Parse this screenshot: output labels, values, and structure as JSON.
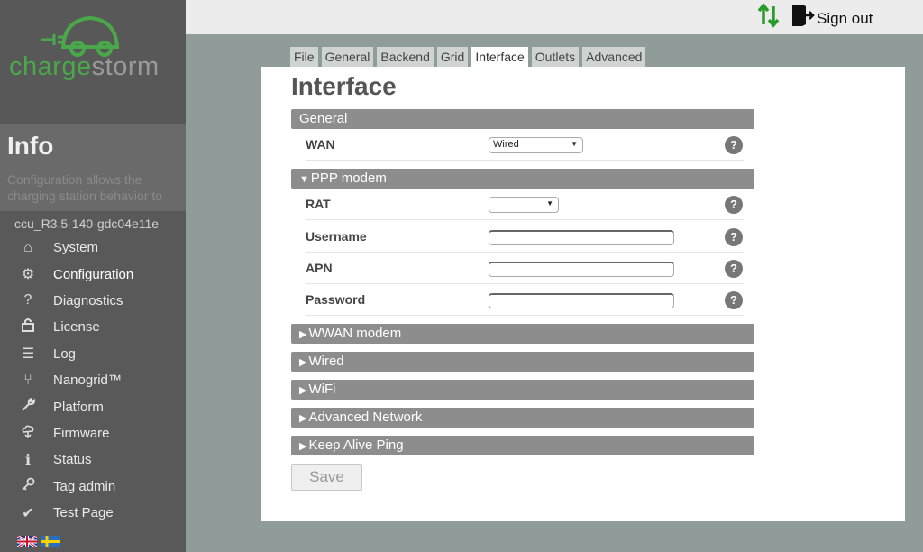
{
  "brand": {
    "part1": "charge",
    "part2": "storm",
    "accent": "#4aa84a"
  },
  "info": {
    "title": "Info",
    "description": "Configuration allows the charging station behavior to"
  },
  "version": "ccu_R3.5-140-gdc04e11e",
  "menu": [
    {
      "label": "System",
      "icon": "home-icon",
      "glyph": "⌂"
    },
    {
      "label": "Configuration",
      "icon": "gear-icon",
      "glyph": "⚙"
    },
    {
      "label": "Diagnostics",
      "icon": "question-icon",
      "glyph": "?"
    },
    {
      "label": "License",
      "icon": "lock-icon",
      "glyph": "🔓"
    },
    {
      "label": "Log",
      "icon": "list-icon",
      "glyph": "☰"
    },
    {
      "label": "Nanogrid™",
      "icon": "network-icon",
      "glyph": "⑂"
    },
    {
      "label": "Platform",
      "icon": "wrench-icon",
      "glyph": "🔧"
    },
    {
      "label": "Firmware",
      "icon": "cloud-icon",
      "glyph": "⛅"
    },
    {
      "label": "Status",
      "icon": "info-icon",
      "glyph": "i"
    },
    {
      "label": "Tag admin",
      "icon": "key-icon",
      "glyph": "⚷"
    },
    {
      "label": "Test Page",
      "icon": "check-icon",
      "glyph": "✔"
    }
  ],
  "topbar": {
    "signout_label": "Sign out",
    "sync_icon": "sync-arrows-icon"
  },
  "tabs": [
    "File",
    "General",
    "Backend",
    "Grid",
    "Interface",
    "Outlets",
    "Advanced"
  ],
  "active_tab": "Interface",
  "page_title": "Interface",
  "sections": {
    "general": "General",
    "ppp": "PPP modem",
    "wwan": "WWAN modem",
    "wired": "Wired",
    "wifi": "WiFi",
    "advanced_network": "Advanced Network",
    "keep_alive": "Keep Alive Ping"
  },
  "fields": {
    "wan": {
      "label": "WAN",
      "value": "Wired"
    },
    "rat": {
      "label": "RAT",
      "value": ""
    },
    "username": {
      "label": "Username",
      "value": ""
    },
    "apn": {
      "label": "APN",
      "value": ""
    },
    "password": {
      "label": "Password",
      "value": ""
    }
  },
  "help_glyph": "?",
  "save_label": "Save"
}
